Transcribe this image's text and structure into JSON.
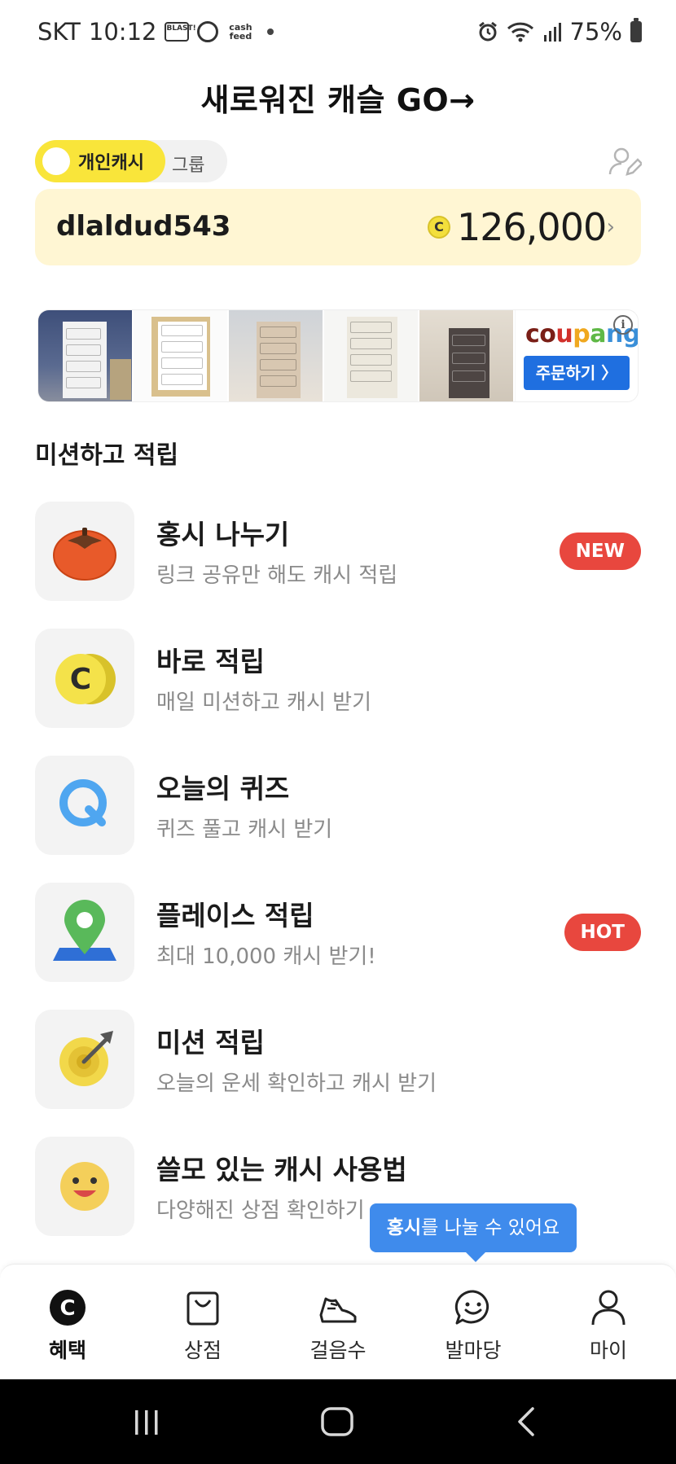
{
  "status_bar": {
    "carrier": "SKT",
    "time": "10:12",
    "notification_apps": [
      "BLAST!",
      "",
      "cash feed"
    ],
    "battery": "75%"
  },
  "promo": {
    "title": "새로워진 캐슬  GO→"
  },
  "toggle": {
    "active_label": "개인캐시",
    "other_label": "그룹"
  },
  "account": {
    "username": "dlaldud543",
    "coin_symbol": "C",
    "balance": "126,000",
    "chevron": "›"
  },
  "ad": {
    "brand": "coupang",
    "order_label": "주문하기 〉",
    "info_symbol": "i"
  },
  "section": {
    "title": "미션하고 적립"
  },
  "missions": [
    {
      "title": "홍시 나누기",
      "subtitle": "링크 공유만 해도 캐시 적립",
      "badge": "NEW",
      "icon": "persimmon-icon"
    },
    {
      "title": "바로 적립",
      "subtitle": "매일 미션하고 캐시 받기",
      "badge": "",
      "icon": "coin-icon"
    },
    {
      "title": "오늘의 퀴즈",
      "subtitle": "퀴즈 풀고 캐시 받기",
      "badge": "",
      "icon": "quiz-icon"
    },
    {
      "title": "플레이스 적립",
      "subtitle": "최대 10,000 캐시 받기!",
      "badge": "HOT",
      "icon": "map-pin-icon"
    },
    {
      "title": "미션 적립",
      "subtitle": "오늘의 운세 확인하고 캐시 받기",
      "badge": "",
      "icon": "target-icon"
    },
    {
      "title": "쓸모 있는 캐시 사용법",
      "subtitle": "다양해진 상점 확인하기",
      "badge": "",
      "icon": "smiley-icon"
    }
  ],
  "tooltip": {
    "bold": "홍시",
    "rest": "를 나눌 수 있어요"
  },
  "bottom_nav": [
    {
      "label": "혜택",
      "icon": "cash-c-icon",
      "active": true
    },
    {
      "label": "상점",
      "icon": "shopping-bag-icon",
      "active": false
    },
    {
      "label": "걸음수",
      "icon": "sneaker-icon",
      "active": false
    },
    {
      "label": "발마당",
      "icon": "chat-smile-icon",
      "active": false
    },
    {
      "label": "마이",
      "icon": "person-icon",
      "active": false
    }
  ],
  "colors": {
    "accent_yellow": "#f9e53a",
    "card_bg": "#fff6d3",
    "badge_red": "#e8473e",
    "tooltip_blue": "#3f8bec",
    "coupang_blue": "#1f6fe0"
  }
}
